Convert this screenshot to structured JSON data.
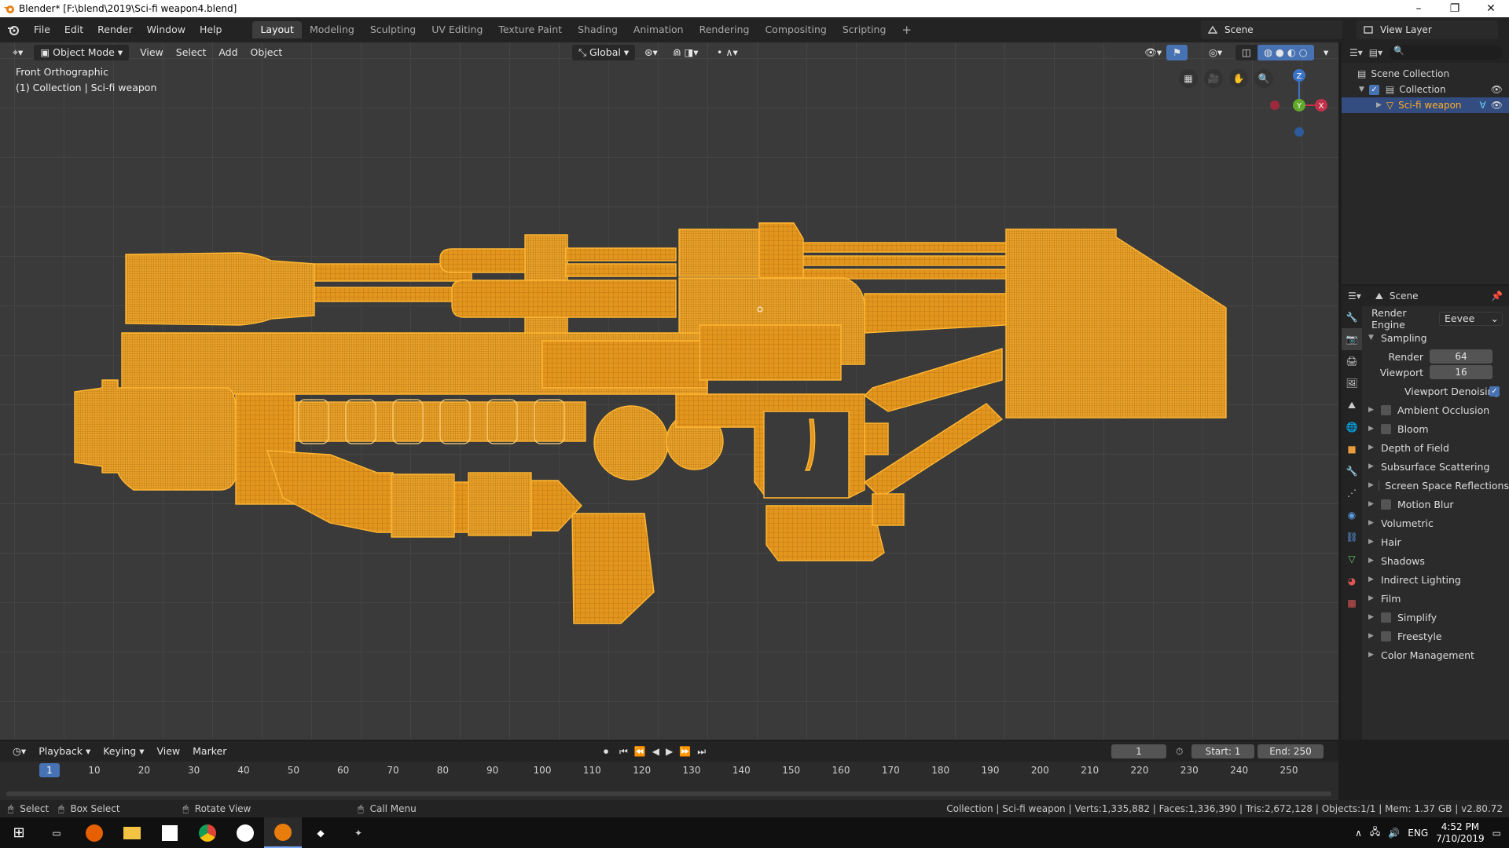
{
  "window": {
    "title": "Blender* [F:\\blend\\2019\\Sci-fi weapon4.blend]",
    "min": "–",
    "max": "❐",
    "close": "✕"
  },
  "menus": [
    "File",
    "Edit",
    "Render",
    "Window",
    "Help"
  ],
  "workspaces": [
    "Layout",
    "Modeling",
    "Sculpting",
    "UV Editing",
    "Texture Paint",
    "Shading",
    "Animation",
    "Rendering",
    "Compositing",
    "Scripting"
  ],
  "add_workspace": "+",
  "scene_label": "Scene",
  "view_layer_label": "View Layer",
  "viewport": {
    "mode": "Object Mode",
    "menus": [
      "View",
      "Select",
      "Add",
      "Object"
    ],
    "orientation": "Global",
    "view_name": "Front Orthographic",
    "collection_info": "(1) Collection | Sci-fi weapon",
    "gizmo": {
      "x": "X",
      "y": "Y",
      "z": "Z"
    }
  },
  "outliner": {
    "root": "Scene Collection",
    "collection": "Collection",
    "object": "Sci-fi weapon"
  },
  "properties": {
    "scene": "Scene",
    "render_engine_label": "Render Engine",
    "render_engine": "Eevee",
    "sampling": "Sampling",
    "render_label": "Render",
    "render_value": "64",
    "viewport_label": "Viewport",
    "viewport_value": "16",
    "denoise_label": "Viewport Denoising",
    "panels": [
      {
        "label": "Ambient Occlusion",
        "check": true
      },
      {
        "label": "Bloom",
        "check": true
      },
      {
        "label": "Depth of Field",
        "check": false
      },
      {
        "label": "Subsurface Scattering",
        "check": false
      },
      {
        "label": "Screen Space Reflections",
        "check": true
      },
      {
        "label": "Motion Blur",
        "check": true
      },
      {
        "label": "Volumetric",
        "check": false
      },
      {
        "label": "Hair",
        "check": false
      },
      {
        "label": "Shadows",
        "check": false
      },
      {
        "label": "Indirect Lighting",
        "check": false
      },
      {
        "label": "Film",
        "check": false
      },
      {
        "label": "Simplify",
        "check": true
      },
      {
        "label": "Freestyle",
        "check": true
      },
      {
        "label": "Color Management",
        "check": false
      }
    ]
  },
  "timeline": {
    "menus": [
      "Playback",
      "Keying",
      "View",
      "Marker"
    ],
    "current_frame": "1",
    "start_label": "Start:",
    "start": "1",
    "end_label": "End:",
    "end": "250",
    "ticks": [
      "1",
      "10",
      "20",
      "30",
      "40",
      "50",
      "60",
      "70",
      "80",
      "90",
      "100",
      "110",
      "120",
      "130",
      "140",
      "150",
      "160",
      "170",
      "180",
      "190",
      "200",
      "210",
      "220",
      "230",
      "240",
      "250"
    ]
  },
  "status": {
    "select": "Select",
    "box_select": "Box Select",
    "rotate": "Rotate View",
    "call_menu": "Call Menu",
    "stats": "Collection | Sci-fi weapon | Verts:1,335,882 | Faces:1,336,390 | Tris:2,672,128 | Objects:1/1 | Mem: 1.37 GB | v2.80.72"
  },
  "taskbar": {
    "lang": "ENG",
    "time": "4:52 PM",
    "date": "7/10/2019"
  },
  "colors": {
    "wire": "#f5a623",
    "selected": "#ffaf29",
    "accent": "#4772b3"
  }
}
